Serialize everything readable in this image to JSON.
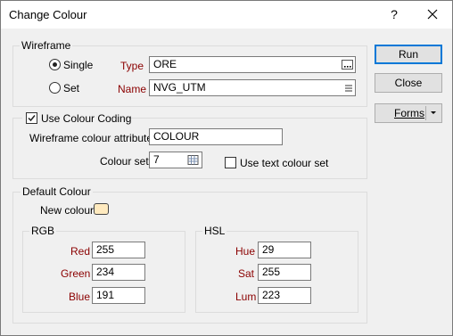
{
  "window": {
    "title": "Change Colour",
    "help_glyph": "?"
  },
  "wireframe": {
    "legend": "Wireframe",
    "single_label": "Single",
    "set_label": "Set",
    "type_label": "Type",
    "type_value": "ORE",
    "name_label": "Name",
    "name_value": "NVG_UTM",
    "selected_mode": "Single"
  },
  "colour_coding": {
    "label": "Use Colour Coding",
    "checked": true,
    "attribute_label": "Wireframe colour attribute",
    "attribute_value": "COLOUR",
    "colour_set_label": "Colour set",
    "colour_set_value": "7",
    "use_text_label": "Use text colour set",
    "use_text_checked": false
  },
  "default_colour": {
    "legend": "Default Colour",
    "new_colour_label": "New colour",
    "swatch_color": "#ffeabf",
    "rgb": {
      "legend": "RGB",
      "red_label": "Red",
      "red": "255",
      "green_label": "Green",
      "green": "234",
      "blue_label": "Blue",
      "blue": "191"
    },
    "hsl": {
      "legend": "HSL",
      "hue_label": "Hue",
      "hue": "29",
      "sat_label": "Sat",
      "sat": "255",
      "lum_label": "Lum",
      "lum": "223"
    }
  },
  "buttons": {
    "run": "Run",
    "close": "Close",
    "forms": "Forms"
  },
  "colors": {
    "accent": "#0078d7",
    "field_label_red": "#8b0000"
  }
}
